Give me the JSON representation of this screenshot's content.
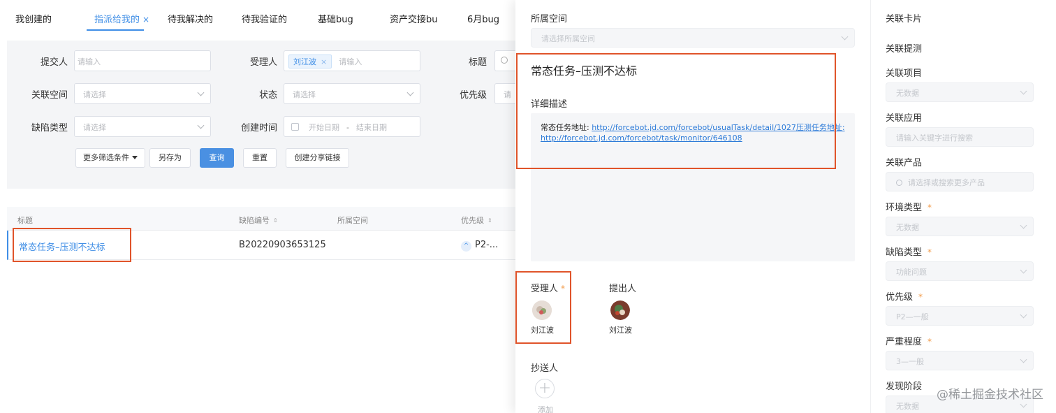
{
  "tabs": {
    "items": [
      {
        "label": "我创建的"
      },
      {
        "label": "指派给我的",
        "close": "×"
      },
      {
        "label": "待我解决的"
      },
      {
        "label": "待我验证的"
      },
      {
        "label": "基础bug"
      },
      {
        "label": "资产交接bu"
      },
      {
        "label": "6月bug"
      }
    ]
  },
  "filters": {
    "submitter": {
      "label": "提交人",
      "placeholder": "请输入"
    },
    "assignee": {
      "label": "受理人",
      "tag": "刘江波",
      "tag_close": "×",
      "placeholder": "请输入"
    },
    "title": {
      "label": "标题"
    },
    "space": {
      "label": "关联空间",
      "placeholder": "请选择"
    },
    "status": {
      "label": "状态",
      "placeholder": "请选择"
    },
    "priority": {
      "label": "优先级",
      "placeholder": "请"
    },
    "defect_type": {
      "label": "缺陷类型",
      "placeholder": "请选择"
    },
    "created": {
      "label": "创建时间",
      "start": "开始日期",
      "sep": "-",
      "end": "结束日期"
    }
  },
  "buttons": {
    "more": "更多筛选条件",
    "save_as": "另存为",
    "query": "查询",
    "reset": "重置",
    "share": "创建分享链接"
  },
  "table": {
    "headers": [
      "标题",
      "缺陷编号",
      "所属空间",
      "优先级"
    ],
    "sort_glyph": "⇕",
    "row": {
      "title": "常态任务–压测不达标",
      "id": "B20220903653125",
      "space": "",
      "priority_icon": "^",
      "priority": "P2-..."
    }
  },
  "drawer": {
    "space_label": "所属空间",
    "space_placeholder": "请选择所属空间",
    "title": "常态任务–压测不达标",
    "desc_label": "详细描述",
    "desc_prefix": "常态任务地址: ",
    "desc_link1": "http://forcebot.jd.com/forcebot/usualTask/detail/1027压测任务地址:",
    "desc_link2": "http://forcebot.jd.com/forcebot/task/monitor/646108",
    "assignee_label": "受理人",
    "required": "*",
    "assignee_name": "刘江波",
    "reporter_label": "提出人",
    "reporter_name": "刘江波",
    "cc_label": "抄送人",
    "cc_add_glyph": "+",
    "cc_add": "添加"
  },
  "side": {
    "card": "关联卡片",
    "test": "关联提测",
    "project": {
      "label": "关联项目",
      "value": "无数据"
    },
    "app": {
      "label": "关联应用",
      "placeholder": "请输入关键字进行搜索"
    },
    "product": {
      "label": "关联产品",
      "placeholder": "请选择或搜索更多产品"
    },
    "env": {
      "label": "环境类型",
      "value": "无数据"
    },
    "defect": {
      "label": "缺陷类型",
      "value": "功能问题"
    },
    "priority": {
      "label": "优先级",
      "value": "P2—一般"
    },
    "severity": {
      "label": "严重程度",
      "value": "3—一般"
    },
    "stage": {
      "label": "发现阶段",
      "value": "无数据"
    }
  },
  "watermark": "@稀土掘金技术社区",
  "colors": {
    "accent": "#3f8ee6",
    "highlight": "#e0542a",
    "required": "#f29b4a"
  }
}
